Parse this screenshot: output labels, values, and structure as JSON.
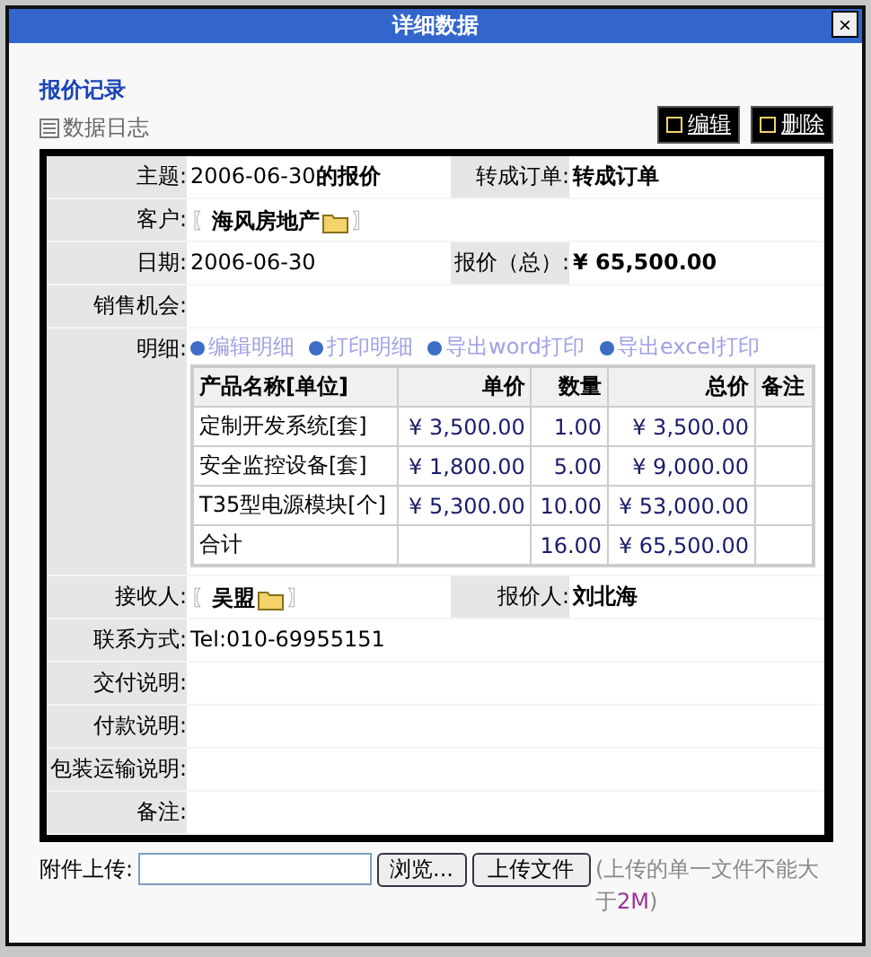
{
  "window": {
    "title": "详细数据",
    "close": "×"
  },
  "section_title": "报价记录",
  "log_link": "数据日志",
  "actions": [
    "编辑",
    "删除"
  ],
  "fields": [
    {
      "kind": "text",
      "label": "主题:",
      "value": "2006-06-30**的报价**",
      "right_label": "转成订单:",
      "right_value": "转成订单"
    },
    {
      "kind": "link",
      "label": "客户:",
      "value": "海风房地产",
      "open": "〖",
      "close": "〗"
    },
    {
      "kind": "text",
      "label": "日期:",
      "value": "2006-06-30",
      "right_label": "报价（总）:",
      "right_value": "¥ 65,500.00"
    },
    {
      "kind": "text",
      "label": "销售机会:"
    },
    {
      "kind": "detail",
      "label": "明细:"
    },
    {
      "kind": "link",
      "label": "接收人:",
      "value": "吴盟",
      "open": "〖",
      "close": "〗",
      "right_label": "报价人:",
      "right_value": "刘北海"
    },
    {
      "kind": "text",
      "label": "联系方式:",
      "value": "Tel:010-69955151"
    },
    {
      "kind": "text",
      "label": "交付说明:"
    },
    {
      "kind": "text",
      "label": "付款说明:"
    },
    {
      "kind": "text",
      "label": "包装运输说明:"
    },
    {
      "kind": "text",
      "label": "备注:"
    }
  ],
  "detail_links": [
    "编辑明细",
    "打印明细",
    "导出word打印",
    "导出excel打印"
  ],
  "table": {
    "columns": [
      "产品名称[单位]",
      "单价",
      "数量",
      "总价",
      "备注"
    ],
    "rows": [
      [
        "定制开发系统[套]",
        "¥ 3,500.00",
        "1.00",
        "¥ 3,500.00"
      ],
      [
        "安全监控设备[套]",
        "¥ 1,800.00",
        "5.00",
        "¥ 9,000.00"
      ],
      [
        "T35型电源模块[个]",
        "¥ 5,300.00",
        "10.00",
        "¥ 53,000.00"
      ],
      [
        "合计",
        "",
        "16.00",
        "¥ 65,500.00"
      ]
    ]
  },
  "upload": {
    "label": "附件上传:",
    "browse": "浏览...",
    "submit": "上传文件",
    "hint": [
      "(上传的单一文件不能大于",
      "2M",
      ")"
    ]
  }
}
